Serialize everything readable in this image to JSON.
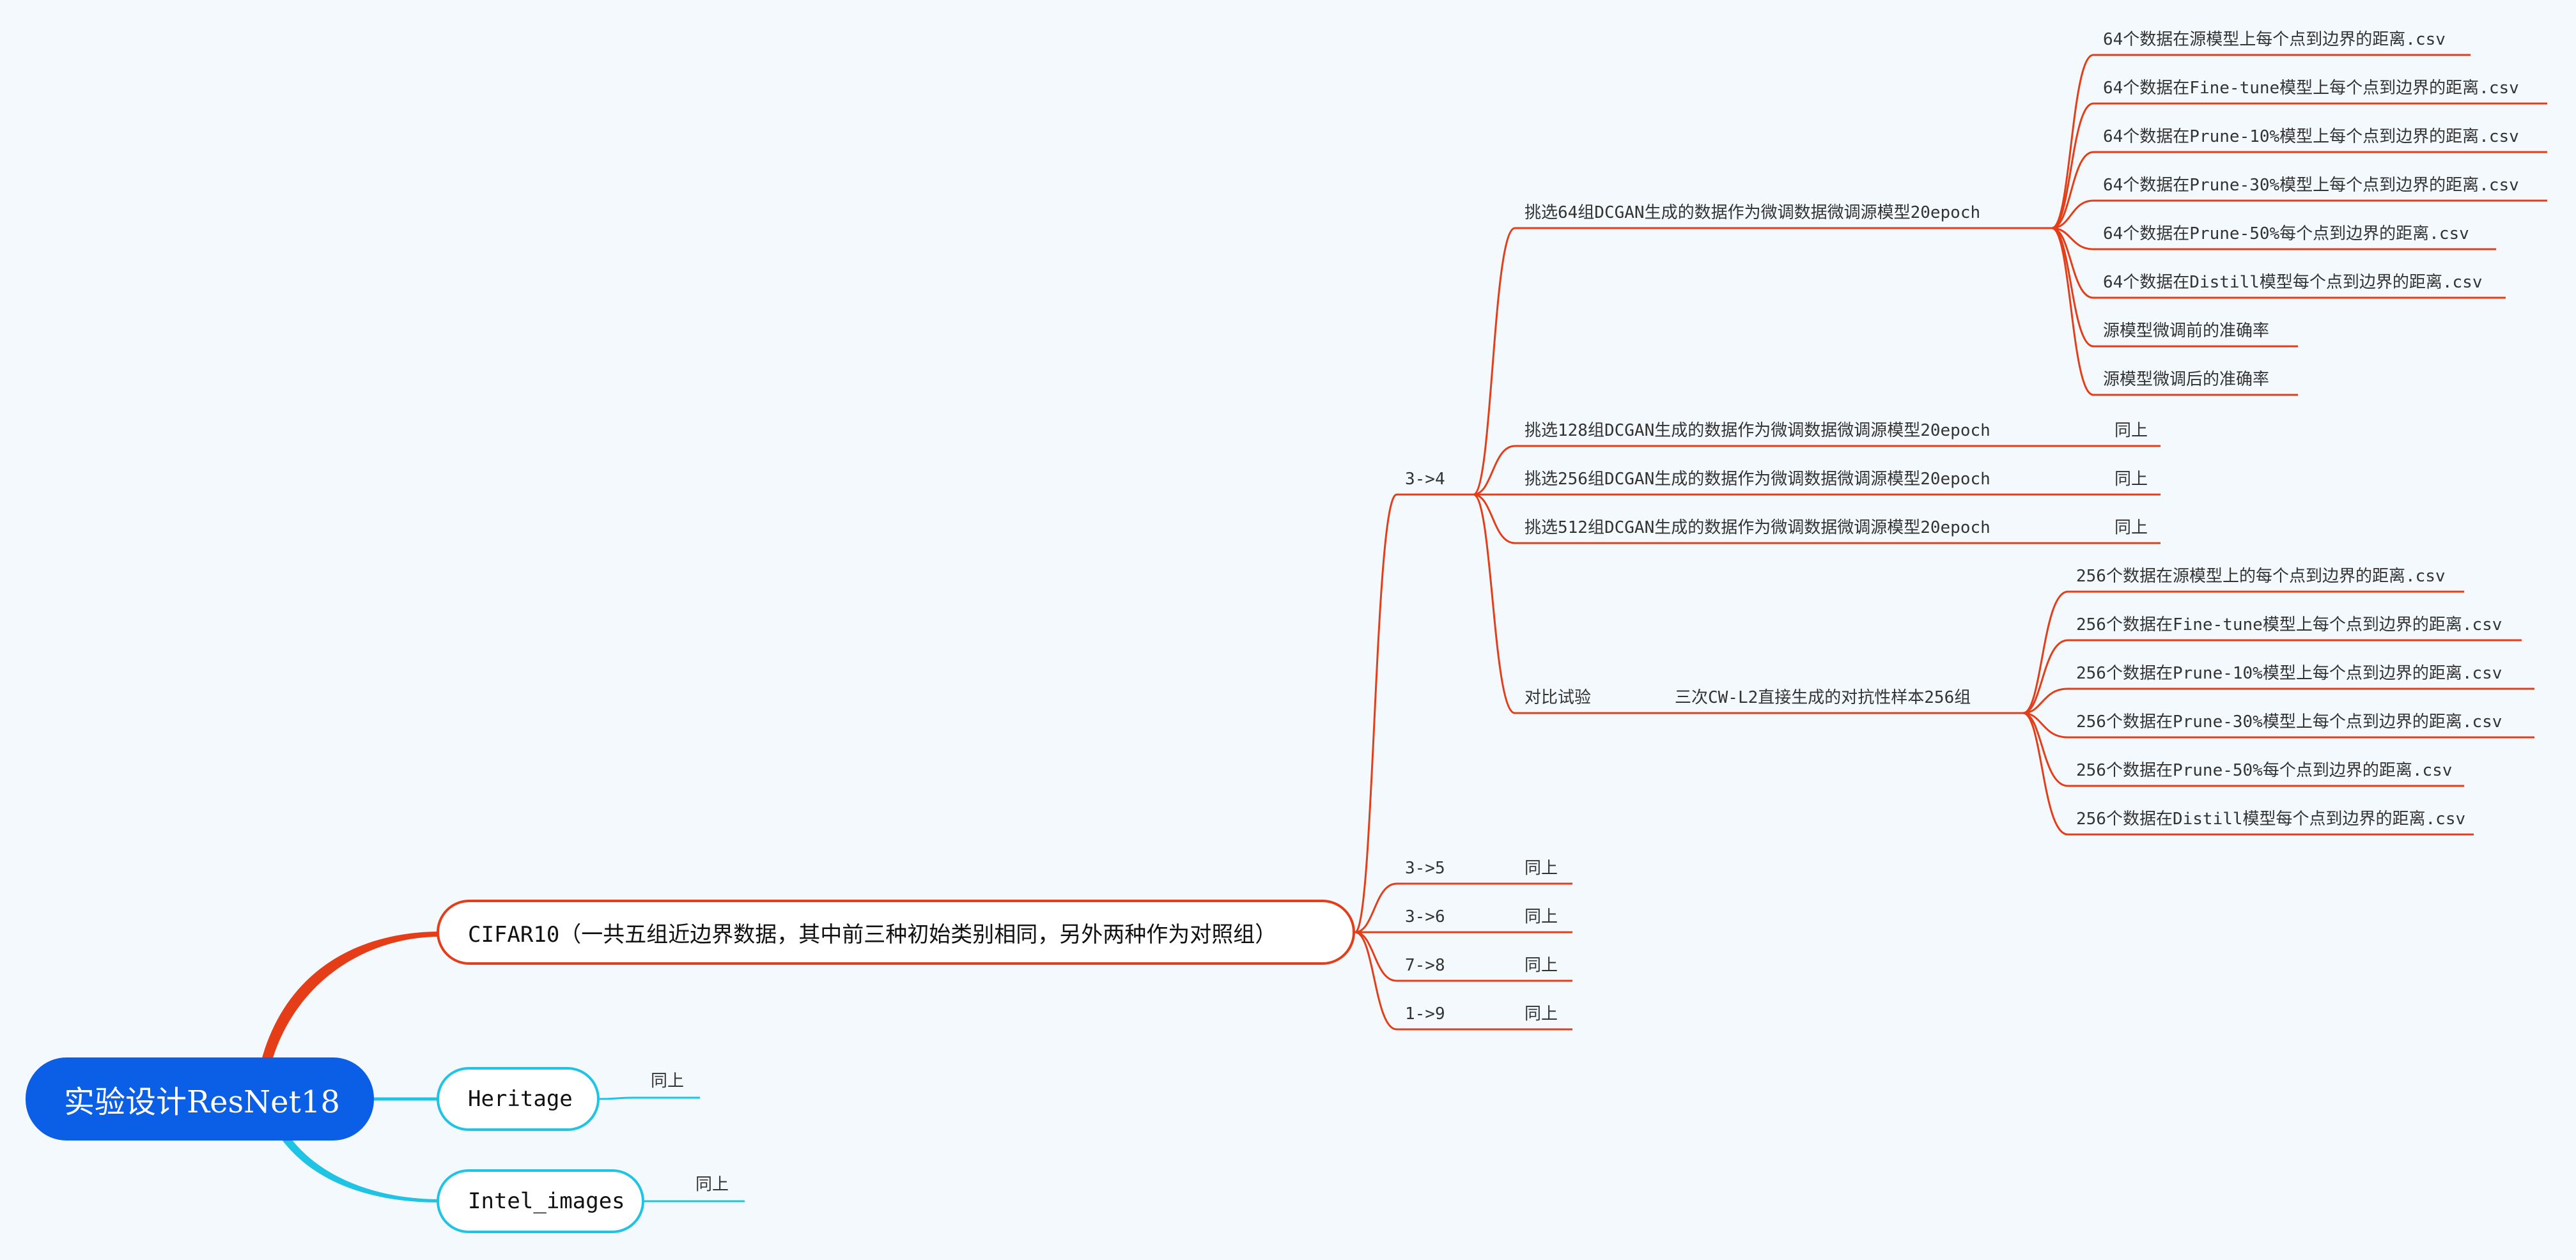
{
  "colors": {
    "background": "#f4f9fd",
    "root": "#0b5ee6",
    "branch_red": "#e43d18",
    "branch_cyan": "#1fc4e4"
  },
  "root": {
    "label": "实验设计ResNet18"
  },
  "branches": [
    {
      "label": "CIFAR10（一共五组近边界数据，其中前三种初始类别相同，另外两种作为对照组）",
      "groups": [
        {
          "label": "3->4",
          "items": [
            {
              "label": "挑选64组DCGAN生成的数据作为微调数据微调源模型20epoch",
              "children": [
                "64个数据在源模型上每个点到边界的距离.csv",
                "64个数据在Fine-tune模型上每个点到边界的距离.csv",
                "64个数据在Prune-10%模型上每个点到边界的距离.csv",
                "64个数据在Prune-30%模型上每个点到边界的距离.csv",
                "64个数据在Prune-50%每个点到边界的距离.csv",
                "64个数据在Distill模型每个点到边界的距离.csv",
                "源模型微调前的准确率",
                "源模型微调后的准确率"
              ]
            },
            {
              "label": "挑选128组DCGAN生成的数据作为微调数据微调源模型20epoch",
              "note": "同上"
            },
            {
              "label": "挑选256组DCGAN生成的数据作为微调数据微调源模型20epoch",
              "note": "同上"
            },
            {
              "label": "挑选512组DCGAN生成的数据作为微调数据微调源模型20epoch",
              "note": "同上"
            },
            {
              "label": "对比试验",
              "sub": "三次CW-L2直接生成的对抗性样本256组",
              "children": [
                "256个数据在源模型上的每个点到边界的距离.csv",
                "256个数据在Fine-tune模型上每个点到边界的距离.csv",
                "256个数据在Prune-10%模型上每个点到边界的距离.csv",
                "256个数据在Prune-30%模型上每个点到边界的距离.csv",
                "256个数据在Prune-50%每个点到边界的距离.csv",
                "256个数据在Distill模型每个点到边界的距离.csv"
              ]
            }
          ]
        },
        {
          "label": "3->5",
          "note": "同上"
        },
        {
          "label": "3->6",
          "note": "同上"
        },
        {
          "label": "7->8",
          "note": "同上"
        },
        {
          "label": "1->9",
          "note": "同上"
        }
      ]
    },
    {
      "label": "Heritage",
      "note": "同上"
    },
    {
      "label": "Intel_images",
      "note": "同上"
    }
  ]
}
